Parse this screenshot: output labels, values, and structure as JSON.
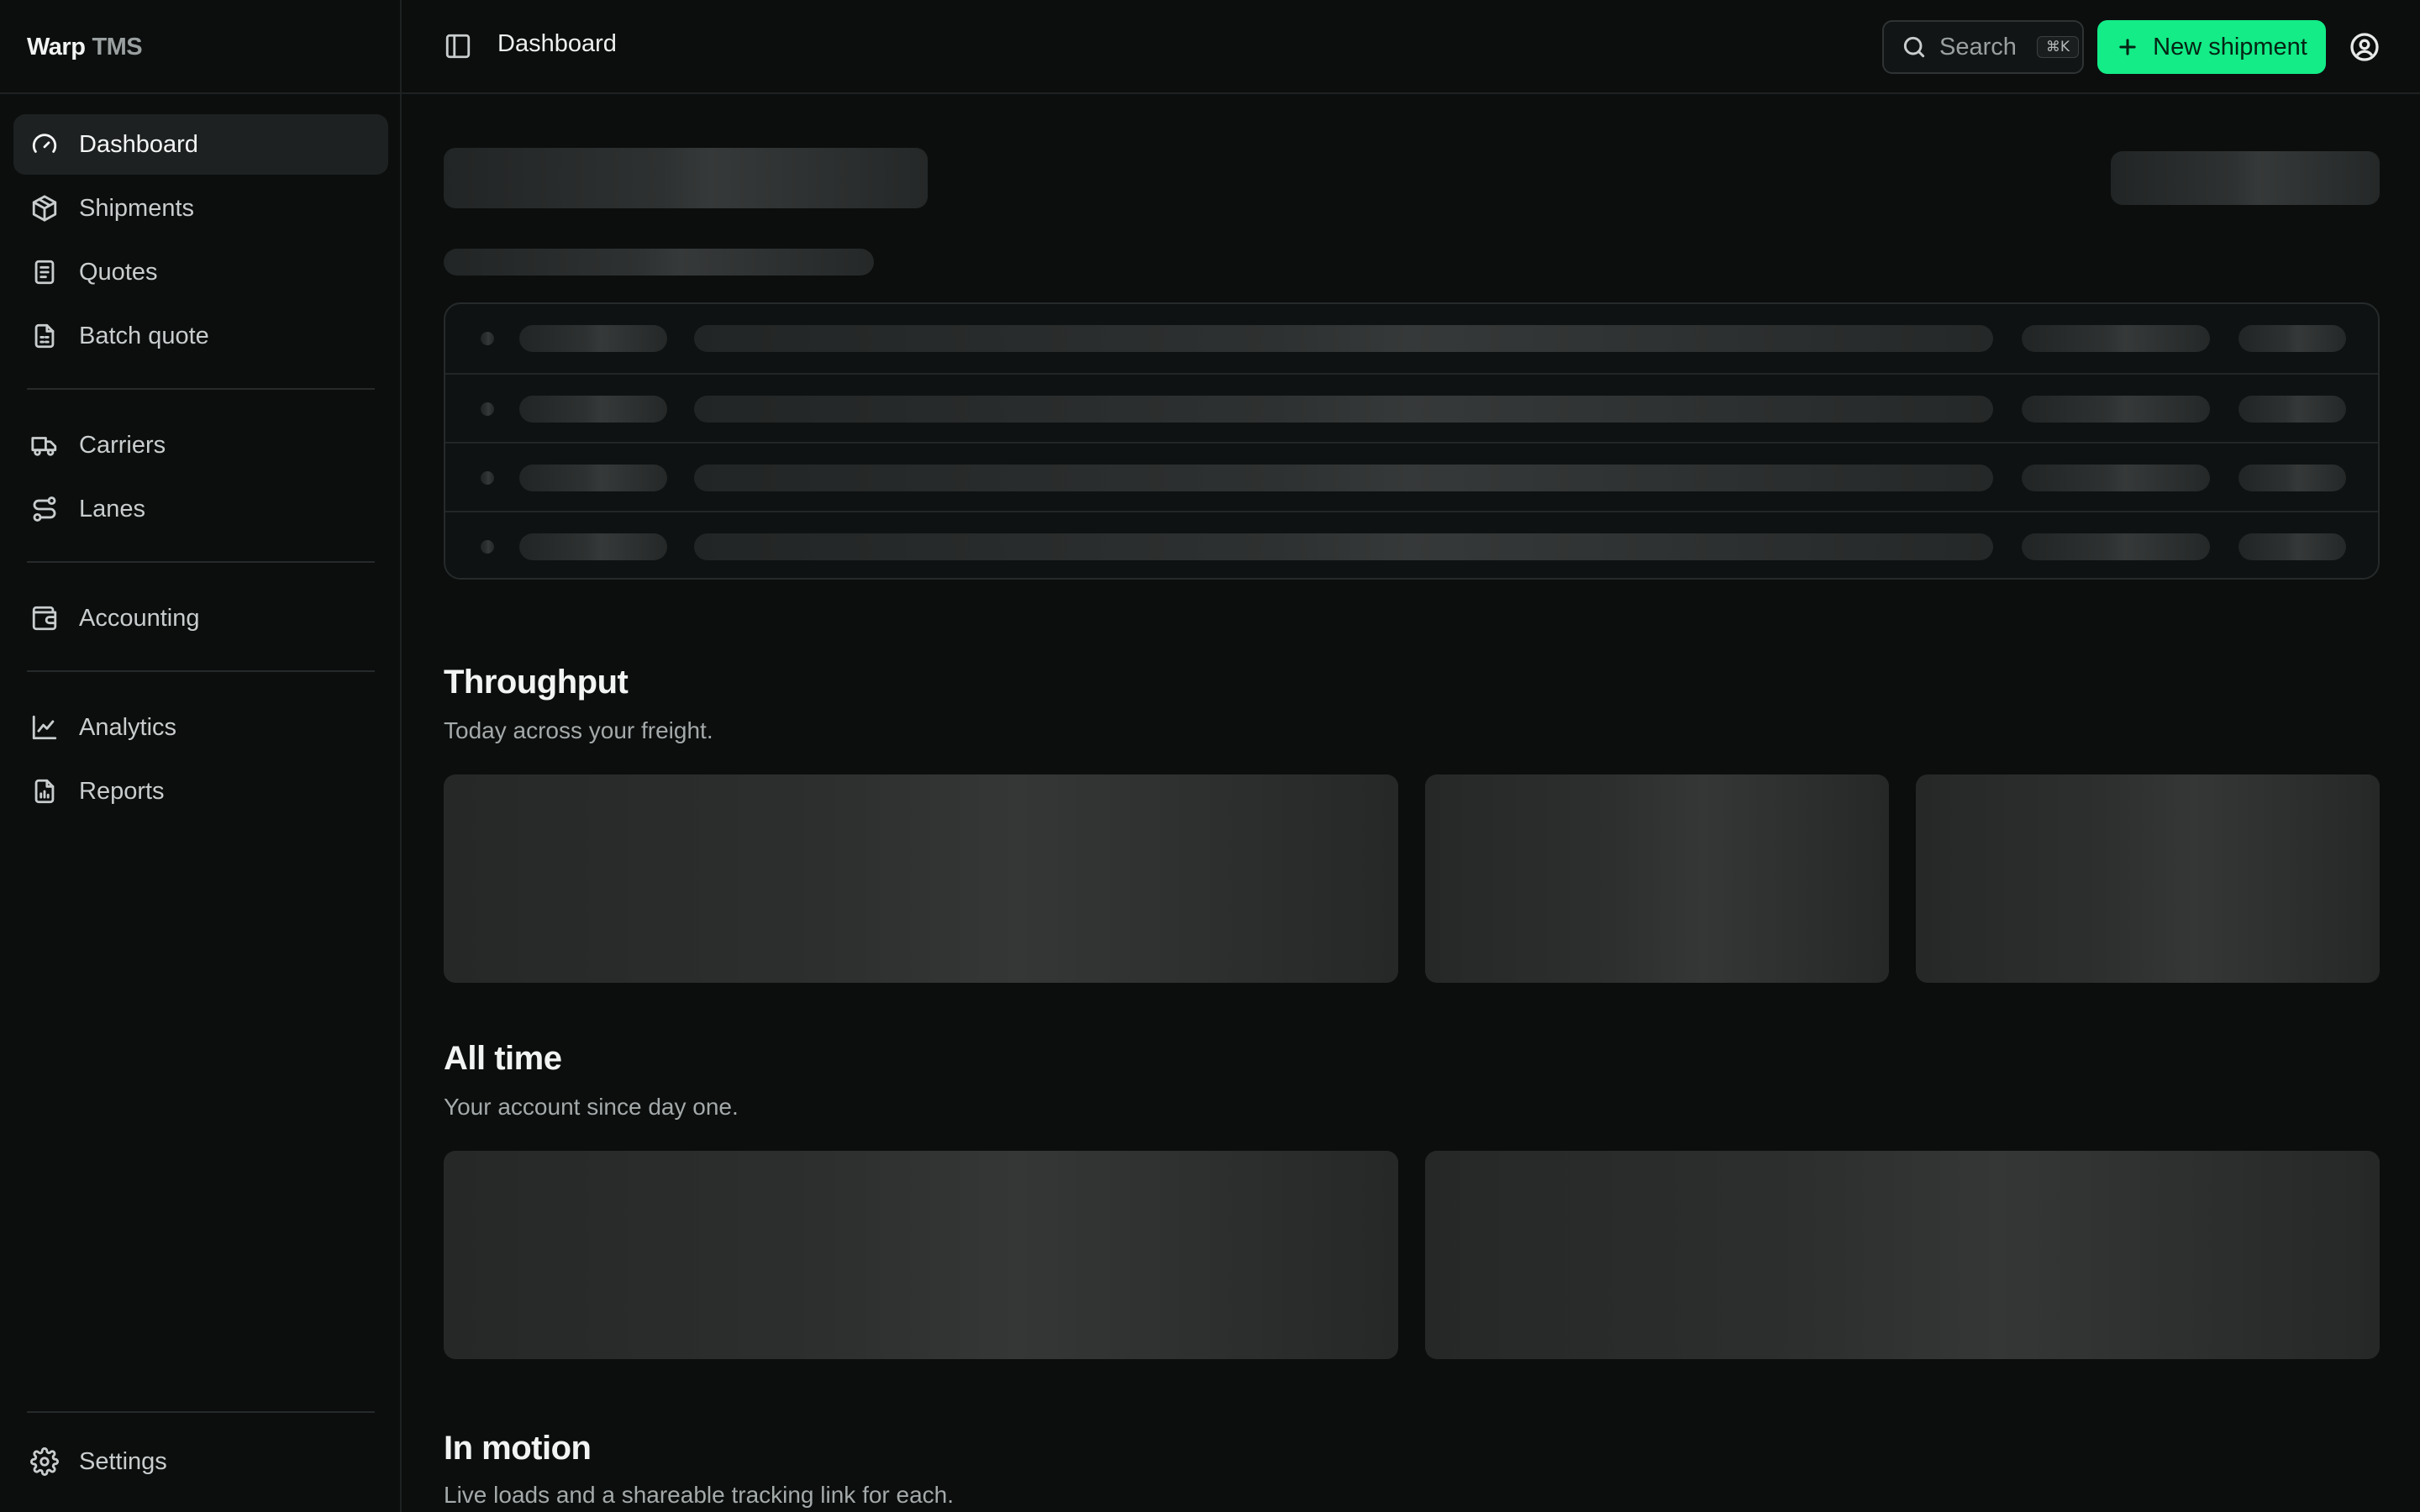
{
  "brand": {
    "name": "Warp",
    "suffix": "TMS"
  },
  "sidebar": {
    "groups": [
      [
        {
          "label": "Dashboard",
          "icon": "gauge-icon",
          "active": true
        },
        {
          "label": "Shipments",
          "icon": "box-icon"
        },
        {
          "label": "Quotes",
          "icon": "receipt-icon"
        },
        {
          "label": "Batch quote",
          "icon": "file-spreadsheet-icon"
        }
      ],
      [
        {
          "label": "Carriers",
          "icon": "truck-icon"
        },
        {
          "label": "Lanes",
          "icon": "route-icon"
        }
      ],
      [
        {
          "label": "Accounting",
          "icon": "wallet-icon"
        }
      ],
      [
        {
          "label": "Analytics",
          "icon": "line-chart-icon"
        },
        {
          "label": "Reports",
          "icon": "file-chart-icon"
        }
      ]
    ],
    "settings": {
      "label": "Settings",
      "icon": "gear-icon"
    }
  },
  "header": {
    "title": "Dashboard",
    "search_label": "Search",
    "search_shortcut": "⌘K",
    "new_button": "New shipment"
  },
  "sections": {
    "throughput": {
      "title": "Throughput",
      "subtitle": "Today across your freight."
    },
    "all_time": {
      "title": "All time",
      "subtitle": "Your account since day one."
    },
    "in_motion": {
      "title": "In motion",
      "subtitle": "Live loads and a shareable tracking link for each."
    }
  },
  "colors": {
    "accent": "#13ec87",
    "background": "#0c0e0e",
    "sidebar_active": "#1e2121"
  }
}
